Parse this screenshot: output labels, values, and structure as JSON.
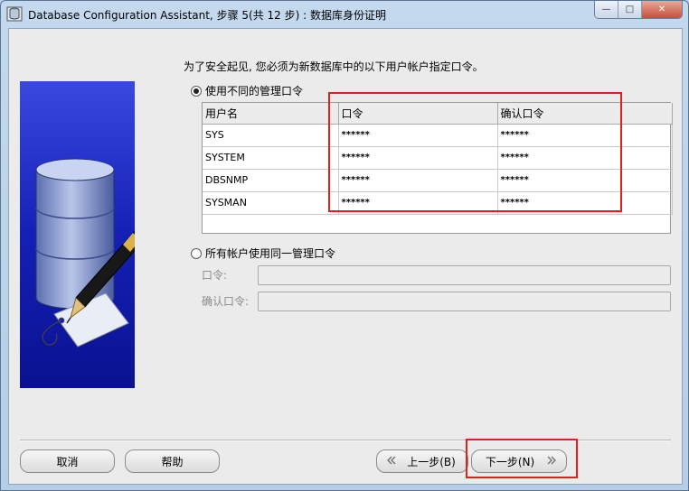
{
  "window": {
    "title": "Database Configuration Assistant, 步骤 5(共 12 步) : 数据库身份证明",
    "app_icon": "database-icon",
    "minimize_glyph": "—",
    "maximize_glyph": "□",
    "close_glyph": "✕"
  },
  "instruction": "为了安全起见, 您必须为新数据库中的以下用户帐户指定口令。",
  "option_different": {
    "label": "使用不同的管理口令",
    "selected": true
  },
  "grid": {
    "columns": [
      "用户名",
      "口令",
      "确认口令"
    ],
    "rows": [
      {
        "user": "SYS",
        "password": "******",
        "confirm": "******"
      },
      {
        "user": "SYSTEM",
        "password": "******",
        "confirm": "******"
      },
      {
        "user": "DBSNMP",
        "password": "******",
        "confirm": "******"
      },
      {
        "user": "SYSMAN",
        "password": "******",
        "confirm": "******"
      }
    ]
  },
  "option_same": {
    "label": "所有帐户使用同一管理口令",
    "selected": false,
    "password_label": "口令:",
    "confirm_label": "确认口令:",
    "password_value": "",
    "confirm_value": ""
  },
  "buttons": {
    "cancel": "取消",
    "help": "帮助",
    "back": "上一步(B)",
    "next": "下一步(N)",
    "back_icon": "chevron-left-double-icon",
    "next_icon": "chevron-right-double-icon"
  },
  "colors": {
    "highlight": "#e02020",
    "side_image_blue": "#1a25c0"
  }
}
